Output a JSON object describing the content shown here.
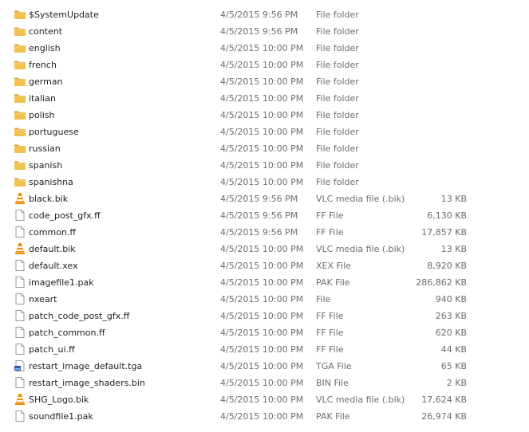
{
  "files": [
    {
      "name": "$SystemUpdate",
      "date": "4/5/2015 9:56 PM",
      "type": "File folder",
      "size": "",
      "icon": "folder-icon"
    },
    {
      "name": "content",
      "date": "4/5/2015 9:56 PM",
      "type": "File folder",
      "size": "",
      "icon": "folder-icon"
    },
    {
      "name": "english",
      "date": "4/5/2015 10:00 PM",
      "type": "File folder",
      "size": "",
      "icon": "folder-icon"
    },
    {
      "name": "french",
      "date": "4/5/2015 10:00 PM",
      "type": "File folder",
      "size": "",
      "icon": "folder-icon"
    },
    {
      "name": "german",
      "date": "4/5/2015 10:00 PM",
      "type": "File folder",
      "size": "",
      "icon": "folder-icon"
    },
    {
      "name": "italian",
      "date": "4/5/2015 10:00 PM",
      "type": "File folder",
      "size": "",
      "icon": "folder-icon"
    },
    {
      "name": "polish",
      "date": "4/5/2015 10:00 PM",
      "type": "File folder",
      "size": "",
      "icon": "folder-icon"
    },
    {
      "name": "portuguese",
      "date": "4/5/2015 10:00 PM",
      "type": "File folder",
      "size": "",
      "icon": "folder-icon"
    },
    {
      "name": "russian",
      "date": "4/5/2015 10:00 PM",
      "type": "File folder",
      "size": "",
      "icon": "folder-icon"
    },
    {
      "name": "spanish",
      "date": "4/5/2015 10:00 PM",
      "type": "File folder",
      "size": "",
      "icon": "folder-icon"
    },
    {
      "name": "spanishna",
      "date": "4/5/2015 10:00 PM",
      "type": "File folder",
      "size": "",
      "icon": "folder-icon"
    },
    {
      "name": "black.bik",
      "date": "4/5/2015 9:56 PM",
      "type": "VLC media file (.bik)",
      "size": "13 KB",
      "icon": "vlc-cone-icon"
    },
    {
      "name": "code_post_gfx.ff",
      "date": "4/5/2015 9:56 PM",
      "type": "FF File",
      "size": "6,130 KB",
      "icon": "blank-file-icon"
    },
    {
      "name": "common.ff",
      "date": "4/5/2015 9:56 PM",
      "type": "FF File",
      "size": "17,857 KB",
      "icon": "blank-file-icon"
    },
    {
      "name": "default.bik",
      "date": "4/5/2015 10:00 PM",
      "type": "VLC media file (.bik)",
      "size": "13 KB",
      "icon": "vlc-cone-icon"
    },
    {
      "name": "default.xex",
      "date": "4/5/2015 10:00 PM",
      "type": "XEX File",
      "size": "8,920 KB",
      "icon": "blank-file-icon"
    },
    {
      "name": "imagefile1.pak",
      "date": "4/5/2015 10:00 PM",
      "type": "PAK File",
      "size": "286,862 KB",
      "icon": "blank-file-icon"
    },
    {
      "name": "nxeart",
      "date": "4/5/2015 10:00 PM",
      "type": "File",
      "size": "940 KB",
      "icon": "blank-file-icon"
    },
    {
      "name": "patch_code_post_gfx.ff",
      "date": "4/5/2015 10:00 PM",
      "type": "FF File",
      "size": "263 KB",
      "icon": "blank-file-icon"
    },
    {
      "name": "patch_common.ff",
      "date": "4/5/2015 10:00 PM",
      "type": "FF File",
      "size": "620 KB",
      "icon": "blank-file-icon"
    },
    {
      "name": "patch_ui.ff",
      "date": "4/5/2015 10:00 PM",
      "type": "FF File",
      "size": "44 KB",
      "icon": "blank-file-icon"
    },
    {
      "name": "restart_image_default.tga",
      "date": "4/5/2015 10:00 PM",
      "type": "TGA File",
      "size": "65 KB",
      "icon": "image-file-icon"
    },
    {
      "name": "restart_image_shaders.bin",
      "date": "4/5/2015 10:00 PM",
      "type": "BIN File",
      "size": "2 KB",
      "icon": "blank-file-icon"
    },
    {
      "name": "SHG_Logo.bik",
      "date": "4/5/2015 10:00 PM",
      "type": "VLC media file (.bik)",
      "size": "17,624 KB",
      "icon": "vlc-cone-icon"
    },
    {
      "name": "soundfile1.pak",
      "date": "4/5/2015 10:00 PM",
      "type": "PAK File",
      "size": "26,974 KB",
      "icon": "blank-file-icon"
    }
  ],
  "colors": {
    "folder": "#f2c14e",
    "folder_dark": "#d9a22f",
    "vlc": "#f08a00",
    "meta_text": "#6d6d6d",
    "name_text": "#1e1e1e"
  }
}
